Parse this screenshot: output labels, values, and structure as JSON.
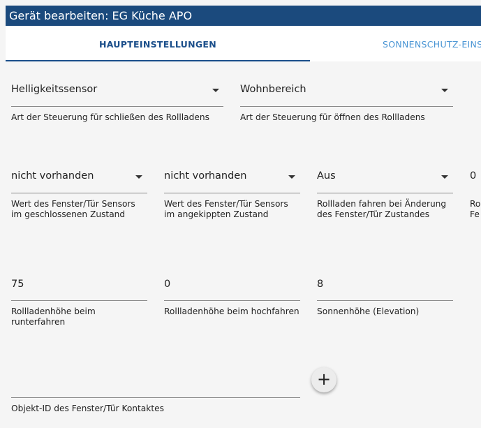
{
  "dialog": {
    "title": "Gerät bearbeiten: EG Küche APO"
  },
  "tabs": [
    {
      "label": "HAUPTEINSTELLUNGEN",
      "active": true
    },
    {
      "label": "SONNENSCHUTZ-EINS",
      "active": false
    }
  ],
  "row1": [
    {
      "value": "Helligkeitssensor",
      "help": "Art der Steuerung für schließen des Rollladens",
      "icon": "chevron-down-icon"
    },
    {
      "value": "Wohnbereich",
      "help": "Art der Steuerung für öffnen des Rollladens",
      "icon": "chevron-down-icon"
    }
  ],
  "row2": [
    {
      "value": "nicht vorhanden",
      "help_line1": "Wert des Fenster/Tür Sensors",
      "help_line2": "im geschlossenen Zustand",
      "icon": "chevron-down-icon"
    },
    {
      "value": "nicht vorhanden",
      "help_line1": "Wert des Fenster/Tür Sensors",
      "help_line2": "im angekippten Zustand",
      "icon": "chevron-down-icon"
    },
    {
      "value": "Aus",
      "help_line1": "Rollladen fahren bei Änderung",
      "help_line2": "des Fenster/Tür Zustandes",
      "icon": "chevron-down-icon"
    },
    {
      "value": "0",
      "help_line1": "Ro",
      "help_line2": "Fe"
    }
  ],
  "row3": [
    {
      "value": "75",
      "help_line1": "Rollladenhöhe beim",
      "help_line2": "runterfahren"
    },
    {
      "value": "0",
      "help_line1": "Rollladenhöhe beim hochfahren",
      "help_line2": ""
    },
    {
      "value": "8",
      "help_line1": "Sonnenhöhe (Elevation)",
      "help_line2": ""
    }
  ],
  "row4": {
    "value": "",
    "help": "Objekt-ID des Fenster/Tür Kontaktes",
    "add_button": "+"
  },
  "colors": {
    "title_bg": "#1b4a7d",
    "active_tab": "#1a4e8a",
    "inactive_tab": "#4a95d4",
    "background": "#f5f5f5"
  }
}
